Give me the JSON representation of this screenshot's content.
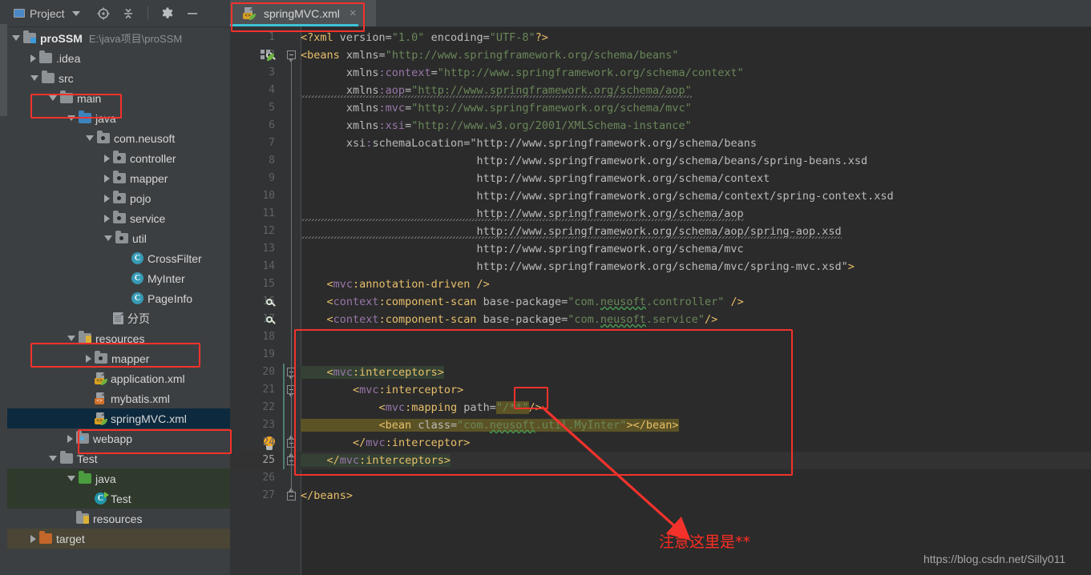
{
  "window": {
    "panel_title": "Project",
    "toolbar_icons": [
      "locate-target-icon",
      "collapse-all-icon",
      "settings-gear-icon",
      "minimize-icon"
    ]
  },
  "project_tree": {
    "root": {
      "name": "proSSM",
      "path": "E:\\java项目\\proSSM"
    },
    "items": [
      {
        "label": "proSSM",
        "path": "E:\\java项目\\proSSM",
        "depth": 0,
        "arrow": "open",
        "icon": "module-folder-icon",
        "state": "normal"
      },
      {
        "label": ".idea",
        "path": "",
        "depth": 1,
        "arrow": "closed",
        "icon": "folder-grey-icon",
        "state": "normal"
      },
      {
        "label": "src",
        "path": "",
        "depth": 1,
        "arrow": "open",
        "icon": "folder-grey-icon",
        "state": "normal"
      },
      {
        "label": "main",
        "path": "",
        "depth": 2,
        "arrow": "open",
        "icon": "folder-grey-icon",
        "state": "normal"
      },
      {
        "label": "java",
        "path": "",
        "depth": 3,
        "arrow": "open",
        "icon": "folder-source-blue-icon",
        "state": "normal"
      },
      {
        "label": "com.neusoft",
        "path": "",
        "depth": 4,
        "arrow": "open",
        "icon": "package-icon",
        "state": "normal"
      },
      {
        "label": "controller",
        "path": "",
        "depth": 5,
        "arrow": "closed",
        "icon": "package-icon",
        "state": "normal"
      },
      {
        "label": "mapper",
        "path": "",
        "depth": 5,
        "arrow": "closed",
        "icon": "package-icon",
        "state": "normal"
      },
      {
        "label": "pojo",
        "path": "",
        "depth": 5,
        "arrow": "closed",
        "icon": "package-icon",
        "state": "normal"
      },
      {
        "label": "service",
        "path": "",
        "depth": 5,
        "arrow": "closed",
        "icon": "package-icon",
        "state": "normal"
      },
      {
        "label": "util",
        "path": "",
        "depth": 5,
        "arrow": "open",
        "icon": "package-icon",
        "state": "normal"
      },
      {
        "label": "CrossFilter",
        "path": "",
        "depth": 6,
        "arrow": "none",
        "icon": "java-class-icon",
        "state": "normal"
      },
      {
        "label": "MyInter",
        "path": "",
        "depth": 6,
        "arrow": "none",
        "icon": "java-class-icon",
        "state": "normal"
      },
      {
        "label": "PageInfo",
        "path": "",
        "depth": 6,
        "arrow": "none",
        "icon": "java-class-icon",
        "state": "normal"
      },
      {
        "label": "分页",
        "path": "",
        "depth": 5,
        "arrow": "none",
        "icon": "text-file-icon",
        "state": "normal"
      },
      {
        "label": "resources",
        "path": "",
        "depth": 3,
        "arrow": "open",
        "icon": "resources-folder-icon",
        "state": "normal"
      },
      {
        "label": "mapper",
        "path": "",
        "depth": 4,
        "arrow": "closed",
        "icon": "package-icon",
        "state": "normal"
      },
      {
        "label": "application.xml",
        "path": "",
        "depth": 4,
        "arrow": "none",
        "icon": "spring-xml-icon",
        "state": "normal"
      },
      {
        "label": "mybatis.xml",
        "path": "",
        "depth": 4,
        "arrow": "none",
        "icon": "xml-file-icon",
        "state": "normal"
      },
      {
        "label": "springMVC.xml",
        "path": "",
        "depth": 4,
        "arrow": "none",
        "icon": "spring-xml-icon",
        "state": "selected"
      },
      {
        "label": "webapp",
        "path": "",
        "depth": 3,
        "arrow": "closed",
        "icon": "webapp-folder-icon",
        "state": "normal"
      },
      {
        "label": "Test",
        "path": "",
        "depth": 2,
        "arrow": "open",
        "icon": "folder-grey-icon",
        "state": "normal"
      },
      {
        "label": "java",
        "path": "",
        "depth": 3,
        "arrow": "open",
        "icon": "folder-test-green-icon",
        "state": "test"
      },
      {
        "label": "Test",
        "path": "",
        "depth": 4,
        "arrow": "none",
        "icon": "java-test-class-icon",
        "state": "test"
      },
      {
        "label": "resources",
        "path": "",
        "depth": 3,
        "arrow": "none",
        "icon": "resources-folder-icon",
        "state": "normal"
      },
      {
        "label": "target",
        "path": "",
        "depth": 1,
        "arrow": "closed",
        "icon": "folder-excluded-orange-icon",
        "state": "target"
      }
    ]
  },
  "editor": {
    "tab": {
      "label": "springMVC.xml",
      "close": "×",
      "icon": "spring-xml-icon"
    },
    "current_line": 25,
    "lines": [
      {
        "n": 1,
        "text": "<?xml version=\"1.0\" encoding=\"UTF-8\"?>"
      },
      {
        "n": 2,
        "text": "<beans xmlns=\"http://www.springframework.org/schema/beans\"",
        "gutter": "spring-bean-gutter-icon"
      },
      {
        "n": 3,
        "text": "       xmlns:context=\"http://www.springframework.org/schema/context\""
      },
      {
        "n": 4,
        "text": "       xmlns:aop=\"http://www.springframework.org/schema/aop\""
      },
      {
        "n": 5,
        "text": "       xmlns:mvc=\"http://www.springframework.org/schema/mvc\""
      },
      {
        "n": 6,
        "text": "       xmlns:xsi=\"http://www.w3.org/2001/XMLSchema-instance\""
      },
      {
        "n": 7,
        "text": "       xsi:schemaLocation=\"http://www.springframework.org/schema/beans"
      },
      {
        "n": 8,
        "text": "                           http://www.springframework.org/schema/beans/spring-beans.xsd"
      },
      {
        "n": 9,
        "text": "                           http://www.springframework.org/schema/context"
      },
      {
        "n": 10,
        "text": "                           http://www.springframework.org/schema/context/spring-context.xsd"
      },
      {
        "n": 11,
        "text": "                           http://www.springframework.org/schema/aop"
      },
      {
        "n": 12,
        "text": "                           http://www.springframework.org/schema/aop/spring-aop.xsd"
      },
      {
        "n": 13,
        "text": "                           http://www.springframework.org/schema/mvc"
      },
      {
        "n": 14,
        "text": "                           http://www.springframework.org/schema/mvc/spring-mvc.xsd\">"
      },
      {
        "n": 15,
        "text": "    <mvc:annotation-driven />"
      },
      {
        "n": 16,
        "text": "    <context:component-scan base-package=\"com.neusoft.controller\" />",
        "gutter": "spring-bean-gutter-icon"
      },
      {
        "n": 17,
        "text": "    <context:component-scan base-package=\"com.neusoft.service\"/>",
        "gutter": "spring-bean-gutter-icon"
      },
      {
        "n": 18,
        "text": ""
      },
      {
        "n": 19,
        "text": ""
      },
      {
        "n": 20,
        "text": "    <mvc:interceptors>"
      },
      {
        "n": 21,
        "text": "        <mvc:interceptor>"
      },
      {
        "n": 22,
        "text": "            <mvc:mapping path=\"/**\"/>"
      },
      {
        "n": 23,
        "text": "            <bean class=\"com.neusoft.util.MyInter\"></bean>",
        "gutter": "intention-bulb-icon"
      },
      {
        "n": 24,
        "text": "        </mvc:interceptor>"
      },
      {
        "n": 25,
        "text": "    </mvc:interceptors>"
      },
      {
        "n": 26,
        "text": ""
      },
      {
        "n": 27,
        "text": "</beans>"
      }
    ]
  },
  "annotations": {
    "note_text": "注意这里是**",
    "watermark": "https://blog.csdn.net/Silly011",
    "highlight_color": "#f4322c",
    "boxes": [
      "tab-springmvc-box",
      "tree-main-box",
      "tree-resources-box",
      "tree-springmvc-box",
      "interceptors-block-box",
      "path-value-box"
    ]
  },
  "colors": {
    "panel_bg": "#3c3f41",
    "editor_bg": "#2b2b2b",
    "gutter_bg": "#313335",
    "selection_navy": "#0d293e",
    "test_source_green": "#2f3a2c",
    "excluded_olive": "#4a4535",
    "tab_active_underline": "#3ec2d6",
    "string_green": "#6a8759",
    "tag_yellow": "#e8bf6a",
    "ns_purple": "#9876aa",
    "find_highlight": "#5b5325",
    "annotation_red": "#f4322c"
  }
}
